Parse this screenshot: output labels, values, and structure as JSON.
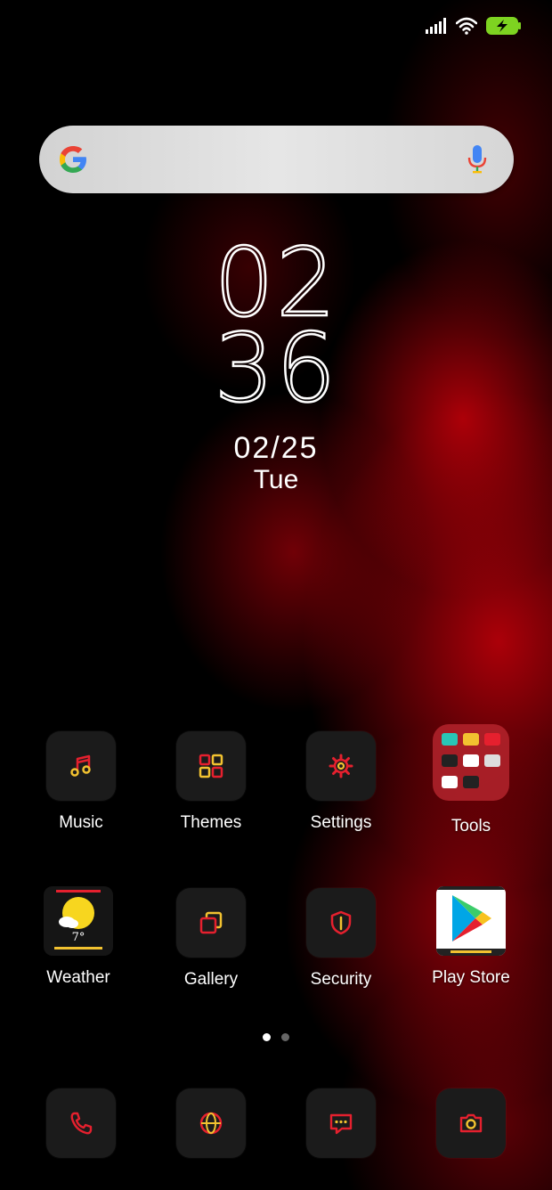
{
  "status_bar": {
    "icons": [
      "signal-icon",
      "wifi-icon",
      "battery-charging-icon"
    ],
    "battery_color": "#7ed321"
  },
  "search": {
    "logo": "google-g-icon",
    "mic": "mic-icon"
  },
  "clock": {
    "hour": "02",
    "minute": "36",
    "date": "02/25",
    "day": "Tue"
  },
  "apps_row1": [
    {
      "label": "Music",
      "icon": "music-icon"
    },
    {
      "label": "Themes",
      "icon": "themes-icon"
    },
    {
      "label": "Settings",
      "icon": "settings-gear-icon"
    },
    {
      "label": "Tools",
      "icon": "folder-icon"
    }
  ],
  "apps_row2": [
    {
      "label": "Weather",
      "icon": "weather-icon",
      "temp": "7°"
    },
    {
      "label": "Gallery",
      "icon": "gallery-icon"
    },
    {
      "label": "Security",
      "icon": "security-shield-icon"
    },
    {
      "label": "Play Store",
      "icon": "play-store-icon"
    }
  ],
  "page_indicator": {
    "pages": 2,
    "active": 1
  },
  "dock": [
    {
      "icon": "phone-icon"
    },
    {
      "icon": "browser-icon"
    },
    {
      "icon": "messages-icon"
    },
    {
      "icon": "camera-icon"
    }
  ],
  "colors": {
    "accent_red": "#e5202e",
    "accent_yellow": "#f2c230",
    "tile_bg": "#1b1b1b"
  }
}
